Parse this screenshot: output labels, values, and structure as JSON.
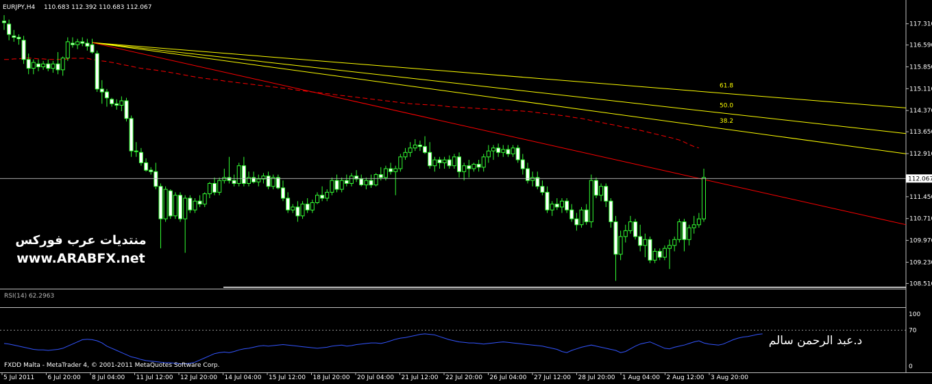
{
  "header": {
    "symbol": "EURJPY,H4",
    "ohlc": "110.683 112.392 110.683 112.067"
  },
  "watermark": {
    "forum_name": "منتديات عرب فوركس",
    "website": "www.ARABFX.net",
    "author": "د.عبد الرحمن سالم"
  },
  "footer": {
    "platform_text": "FXDD Malta - MetaTrader 4, © 2001-2011 MetaQuotes Software Corp."
  },
  "rsi": {
    "label": "RSI(14) 62.2963",
    "levels": [
      "100",
      "70",
      "0"
    ]
  },
  "fibonacci": {
    "levels": [
      "61.8",
      "50.0",
      "38.2"
    ]
  },
  "colors": {
    "background": "#000000",
    "candle_outline": "#33ff33",
    "bull_body": "#000000",
    "bear_body": "#ffffff",
    "fib_lines": "#ffff00",
    "trendline": "#ff0000",
    "moving_average": "#ff0000",
    "rsi_line": "#3355ff",
    "grid": "#c0c0c0"
  },
  "chart_data": {
    "type": "candlestick",
    "instrument": "EURJPY",
    "timeframe": "H4",
    "price_axis_ticks": [
      "117.310",
      "116.590",
      "115.850",
      "115.110",
      "114.370",
      "113.650",
      "112.910",
      "111.450",
      "110.710",
      "109.970",
      "109.230",
      "108.510"
    ],
    "current_price": "112.067",
    "time_axis_ticks": [
      "5 Jul 2011",
      "6 Jul 20:00",
      "8 Jul 04:00",
      "11 Jul 12:00",
      "12 Jul 20:00",
      "14 Jul 04:00",
      "15 Jul 12:00",
      "18 Jul 20:00",
      "20 Jul 04:00",
      "21 Jul 12:00",
      "22 Jul 20:00",
      "26 Jul 04:00",
      "27 Jul 12:00",
      "28 Jul 20:00",
      "1 Aug 04:00",
      "2 Aug 12:00",
      "3 Aug 20:00"
    ],
    "ylim": [
      108.45,
      117.65
    ],
    "candles": [
      {
        "o": 117.4,
        "h": 117.6,
        "l": 117.1,
        "c": 117.35
      },
      {
        "o": 117.3,
        "h": 117.45,
        "l": 116.75,
        "c": 116.95
      },
      {
        "o": 116.9,
        "h": 117.1,
        "l": 116.7,
        "c": 116.85
      },
      {
        "o": 116.85,
        "h": 116.95,
        "l": 116.6,
        "c": 116.8
      },
      {
        "o": 116.75,
        "h": 116.9,
        "l": 115.95,
        "c": 116.1
      },
      {
        "o": 116.1,
        "h": 116.3,
        "l": 115.6,
        "c": 115.8
      },
      {
        "o": 115.8,
        "h": 116.1,
        "l": 115.6,
        "c": 116.0
      },
      {
        "o": 115.95,
        "h": 116.1,
        "l": 115.7,
        "c": 115.85
      },
      {
        "o": 115.85,
        "h": 116.05,
        "l": 115.75,
        "c": 115.95
      },
      {
        "o": 115.95,
        "h": 116.1,
        "l": 115.7,
        "c": 115.8
      },
      {
        "o": 115.8,
        "h": 116.05,
        "l": 115.65,
        "c": 115.95
      },
      {
        "o": 115.95,
        "h": 116.35,
        "l": 115.6,
        "c": 115.75
      },
      {
        "o": 115.75,
        "h": 116.2,
        "l": 115.55,
        "c": 116.15
      },
      {
        "o": 116.15,
        "h": 116.85,
        "l": 116.05,
        "c": 116.7
      },
      {
        "o": 116.65,
        "h": 116.85,
        "l": 116.5,
        "c": 116.6
      },
      {
        "o": 116.6,
        "h": 116.8,
        "l": 116.45,
        "c": 116.7
      },
      {
        "o": 116.7,
        "h": 116.85,
        "l": 116.55,
        "c": 116.65
      },
      {
        "o": 116.65,
        "h": 116.8,
        "l": 116.4,
        "c": 116.55
      },
      {
        "o": 116.6,
        "h": 116.8,
        "l": 116.3,
        "c": 116.35
      },
      {
        "o": 116.3,
        "h": 116.4,
        "l": 115.0,
        "c": 115.1
      },
      {
        "o": 115.1,
        "h": 115.4,
        "l": 114.6,
        "c": 115.0
      },
      {
        "o": 115.0,
        "h": 115.1,
        "l": 114.5,
        "c": 114.8
      },
      {
        "o": 114.75,
        "h": 114.8,
        "l": 114.5,
        "c": 114.6
      },
      {
        "o": 114.6,
        "h": 114.75,
        "l": 114.4,
        "c": 114.55
      },
      {
        "o": 114.55,
        "h": 114.85,
        "l": 114.35,
        "c": 114.7
      },
      {
        "o": 114.7,
        "h": 114.8,
        "l": 114.0,
        "c": 114.1
      },
      {
        "o": 114.1,
        "h": 114.2,
        "l": 112.8,
        "c": 113.0
      },
      {
        "o": 113.0,
        "h": 113.3,
        "l": 112.8,
        "c": 113.0
      },
      {
        "o": 112.95,
        "h": 113.1,
        "l": 112.5,
        "c": 112.6
      },
      {
        "o": 112.6,
        "h": 112.75,
        "l": 112.3,
        "c": 112.35
      },
      {
        "o": 112.35,
        "h": 112.45,
        "l": 112.2,
        "c": 112.3
      },
      {
        "o": 112.3,
        "h": 112.6,
        "l": 111.7,
        "c": 111.8
      },
      {
        "o": 111.8,
        "h": 111.9,
        "l": 109.7,
        "c": 110.7
      },
      {
        "o": 110.7,
        "h": 111.8,
        "l": 110.6,
        "c": 111.7
      },
      {
        "o": 111.65,
        "h": 111.7,
        "l": 110.7,
        "c": 110.8
      },
      {
        "o": 110.8,
        "h": 111.6,
        "l": 110.7,
        "c": 111.5
      },
      {
        "o": 111.5,
        "h": 111.6,
        "l": 110.6,
        "c": 110.7
      },
      {
        "o": 110.7,
        "h": 111.5,
        "l": 109.55,
        "c": 111.4
      },
      {
        "o": 111.4,
        "h": 111.5,
        "l": 110.9,
        "c": 111.0
      },
      {
        "o": 111.0,
        "h": 111.4,
        "l": 110.9,
        "c": 111.3
      },
      {
        "o": 111.3,
        "h": 111.5,
        "l": 111.1,
        "c": 111.2
      },
      {
        "o": 111.2,
        "h": 111.6,
        "l": 111.1,
        "c": 111.55
      },
      {
        "o": 111.55,
        "h": 111.95,
        "l": 111.4,
        "c": 111.9
      },
      {
        "o": 111.9,
        "h": 112.1,
        "l": 111.5,
        "c": 111.6
      },
      {
        "o": 111.6,
        "h": 112.1,
        "l": 111.5,
        "c": 112.0
      },
      {
        "o": 112.0,
        "h": 112.4,
        "l": 111.9,
        "c": 112.1
      },
      {
        "o": 112.1,
        "h": 112.8,
        "l": 111.9,
        "c": 112.0
      },
      {
        "o": 112.0,
        "h": 112.2,
        "l": 111.8,
        "c": 111.9
      },
      {
        "o": 111.9,
        "h": 112.6,
        "l": 111.8,
        "c": 112.5
      },
      {
        "o": 112.5,
        "h": 112.8,
        "l": 111.8,
        "c": 111.9
      },
      {
        "o": 111.9,
        "h": 112.3,
        "l": 111.8,
        "c": 112.1
      },
      {
        "o": 112.1,
        "h": 112.3,
        "l": 111.9,
        "c": 111.95
      },
      {
        "o": 111.95,
        "h": 112.2,
        "l": 111.8,
        "c": 112.05
      },
      {
        "o": 112.05,
        "h": 112.25,
        "l": 111.9,
        "c": 112.15
      },
      {
        "o": 112.15,
        "h": 112.3,
        "l": 111.7,
        "c": 111.8
      },
      {
        "o": 111.8,
        "h": 112.2,
        "l": 111.7,
        "c": 112.1
      },
      {
        "o": 112.1,
        "h": 112.2,
        "l": 111.7,
        "c": 111.75
      },
      {
        "o": 111.75,
        "h": 112.0,
        "l": 111.3,
        "c": 111.4
      },
      {
        "o": 111.4,
        "h": 111.6,
        "l": 110.9,
        "c": 111.0
      },
      {
        "o": 111.0,
        "h": 111.2,
        "l": 110.9,
        "c": 111.1
      },
      {
        "o": 111.1,
        "h": 111.3,
        "l": 110.6,
        "c": 110.8
      },
      {
        "o": 110.8,
        "h": 111.3,
        "l": 110.7,
        "c": 111.2
      },
      {
        "o": 111.2,
        "h": 111.4,
        "l": 110.9,
        "c": 111.0
      },
      {
        "o": 111.0,
        "h": 111.35,
        "l": 110.9,
        "c": 111.25
      },
      {
        "o": 111.25,
        "h": 111.6,
        "l": 111.2,
        "c": 111.5
      },
      {
        "o": 111.5,
        "h": 111.8,
        "l": 111.3,
        "c": 111.4
      },
      {
        "o": 111.4,
        "h": 111.7,
        "l": 111.3,
        "c": 111.6
      },
      {
        "o": 111.6,
        "h": 112.1,
        "l": 111.5,
        "c": 112.0
      },
      {
        "o": 112.0,
        "h": 112.2,
        "l": 111.6,
        "c": 111.7
      },
      {
        "o": 111.7,
        "h": 112.1,
        "l": 111.6,
        "c": 112.0
      },
      {
        "o": 112.0,
        "h": 112.2,
        "l": 111.8,
        "c": 111.9
      },
      {
        "o": 111.9,
        "h": 112.25,
        "l": 111.8,
        "c": 112.15
      },
      {
        "o": 112.15,
        "h": 112.35,
        "l": 111.95,
        "c": 112.05
      },
      {
        "o": 112.05,
        "h": 112.2,
        "l": 111.8,
        "c": 111.85
      },
      {
        "o": 111.85,
        "h": 112.1,
        "l": 111.7,
        "c": 112.0
      },
      {
        "o": 112.0,
        "h": 112.2,
        "l": 111.75,
        "c": 111.85
      },
      {
        "o": 111.85,
        "h": 112.25,
        "l": 111.8,
        "c": 112.2
      },
      {
        "o": 112.2,
        "h": 112.45,
        "l": 112.0,
        "c": 112.1
      },
      {
        "o": 112.1,
        "h": 112.5,
        "l": 112.0,
        "c": 112.4
      },
      {
        "o": 112.4,
        "h": 112.6,
        "l": 112.2,
        "c": 112.3
      },
      {
        "o": 112.3,
        "h": 112.5,
        "l": 111.5,
        "c": 112.4
      },
      {
        "o": 112.4,
        "h": 112.9,
        "l": 112.3,
        "c": 112.8
      },
      {
        "o": 112.8,
        "h": 113.1,
        "l": 112.7,
        "c": 112.95
      },
      {
        "o": 112.95,
        "h": 113.3,
        "l": 112.8,
        "c": 113.1
      },
      {
        "o": 113.1,
        "h": 113.4,
        "l": 113.0,
        "c": 113.2
      },
      {
        "o": 113.2,
        "h": 113.35,
        "l": 113.0,
        "c": 113.15
      },
      {
        "o": 113.15,
        "h": 113.5,
        "l": 112.9,
        "c": 112.95
      },
      {
        "o": 112.95,
        "h": 113.3,
        "l": 112.4,
        "c": 112.5
      },
      {
        "o": 112.5,
        "h": 112.8,
        "l": 112.3,
        "c": 112.7
      },
      {
        "o": 112.7,
        "h": 112.8,
        "l": 112.4,
        "c": 112.6
      },
      {
        "o": 112.6,
        "h": 112.8,
        "l": 112.4,
        "c": 112.7
      },
      {
        "o": 112.7,
        "h": 112.85,
        "l": 112.4,
        "c": 112.5
      },
      {
        "o": 112.5,
        "h": 112.9,
        "l": 112.4,
        "c": 112.8
      },
      {
        "o": 112.8,
        "h": 112.95,
        "l": 112.1,
        "c": 112.3
      },
      {
        "o": 112.3,
        "h": 112.6,
        "l": 112.0,
        "c": 112.5
      },
      {
        "o": 112.5,
        "h": 112.7,
        "l": 112.1,
        "c": 112.4
      },
      {
        "o": 112.4,
        "h": 112.6,
        "l": 112.3,
        "c": 112.55
      },
      {
        "o": 112.55,
        "h": 112.7,
        "l": 112.3,
        "c": 112.45
      },
      {
        "o": 112.45,
        "h": 112.9,
        "l": 112.3,
        "c": 112.8
      },
      {
        "o": 112.8,
        "h": 113.2,
        "l": 112.6,
        "c": 113.0
      },
      {
        "o": 113.0,
        "h": 113.2,
        "l": 112.7,
        "c": 113.1
      },
      {
        "o": 113.1,
        "h": 113.25,
        "l": 112.8,
        "c": 112.95
      },
      {
        "o": 112.95,
        "h": 113.2,
        "l": 112.8,
        "c": 113.05
      },
      {
        "o": 113.05,
        "h": 113.2,
        "l": 112.8,
        "c": 112.9
      },
      {
        "o": 112.9,
        "h": 113.2,
        "l": 112.8,
        "c": 113.1
      },
      {
        "o": 113.1,
        "h": 113.2,
        "l": 112.6,
        "c": 112.7
      },
      {
        "o": 112.7,
        "h": 112.9,
        "l": 112.2,
        "c": 112.4
      },
      {
        "o": 112.4,
        "h": 112.6,
        "l": 111.9,
        "c": 112.0
      },
      {
        "o": 112.0,
        "h": 112.3,
        "l": 111.8,
        "c": 112.1
      },
      {
        "o": 112.1,
        "h": 112.3,
        "l": 111.7,
        "c": 111.8
      },
      {
        "o": 111.8,
        "h": 112.0,
        "l": 111.5,
        "c": 111.6
      },
      {
        "o": 111.6,
        "h": 111.8,
        "l": 110.9,
        "c": 111.0
      },
      {
        "o": 111.0,
        "h": 111.3,
        "l": 110.8,
        "c": 111.2
      },
      {
        "o": 111.2,
        "h": 111.4,
        "l": 111.0,
        "c": 111.1
      },
      {
        "o": 111.1,
        "h": 111.4,
        "l": 110.9,
        "c": 111.3
      },
      {
        "o": 111.3,
        "h": 111.4,
        "l": 110.9,
        "c": 111.0
      },
      {
        "o": 111.0,
        "h": 111.2,
        "l": 110.6,
        "c": 110.7
      },
      {
        "o": 110.7,
        "h": 110.9,
        "l": 110.3,
        "c": 110.5
      },
      {
        "o": 110.5,
        "h": 111.1,
        "l": 110.4,
        "c": 111.0
      },
      {
        "o": 111.0,
        "h": 111.2,
        "l": 110.5,
        "c": 110.6
      },
      {
        "o": 110.6,
        "h": 112.2,
        "l": 110.4,
        "c": 112.0
      },
      {
        "o": 112.0,
        "h": 112.1,
        "l": 111.4,
        "c": 111.5
      },
      {
        "o": 111.5,
        "h": 111.9,
        "l": 111.3,
        "c": 111.8
      },
      {
        "o": 111.8,
        "h": 111.9,
        "l": 111.1,
        "c": 111.3
      },
      {
        "o": 111.3,
        "h": 111.4,
        "l": 110.4,
        "c": 110.6
      },
      {
        "o": 110.6,
        "h": 110.8,
        "l": 108.6,
        "c": 109.5
      },
      {
        "o": 109.5,
        "h": 110.3,
        "l": 109.3,
        "c": 110.1
      },
      {
        "o": 110.1,
        "h": 110.5,
        "l": 109.9,
        "c": 110.3
      },
      {
        "o": 110.3,
        "h": 110.8,
        "l": 110.2,
        "c": 110.6
      },
      {
        "o": 110.6,
        "h": 110.7,
        "l": 110.0,
        "c": 110.1
      },
      {
        "o": 110.1,
        "h": 110.5,
        "l": 109.6,
        "c": 109.8
      },
      {
        "o": 109.8,
        "h": 110.2,
        "l": 109.4,
        "c": 110.0
      },
      {
        "o": 110.0,
        "h": 110.1,
        "l": 109.2,
        "c": 109.3
      },
      {
        "o": 109.3,
        "h": 109.7,
        "l": 109.2,
        "c": 109.6
      },
      {
        "o": 109.6,
        "h": 109.7,
        "l": 109.3,
        "c": 109.4
      },
      {
        "o": 109.4,
        "h": 109.8,
        "l": 109.3,
        "c": 109.7
      },
      {
        "o": 109.7,
        "h": 110.0,
        "l": 109.0,
        "c": 109.8
      },
      {
        "o": 109.8,
        "h": 110.1,
        "l": 109.6,
        "c": 110.0
      },
      {
        "o": 110.0,
        "h": 110.7,
        "l": 109.9,
        "c": 110.6
      },
      {
        "o": 110.6,
        "h": 110.7,
        "l": 109.6,
        "c": 110.0
      },
      {
        "o": 110.0,
        "h": 110.5,
        "l": 109.8,
        "c": 110.4
      },
      {
        "o": 110.4,
        "h": 110.8,
        "l": 110.2,
        "c": 110.5
      },
      {
        "o": 110.5,
        "h": 110.9,
        "l": 110.4,
        "c": 110.7
      },
      {
        "o": 110.7,
        "h": 112.4,
        "l": 110.6,
        "c": 112.1
      }
    ],
    "moving_average": [
      116.1,
      116.1,
      116.12,
      116.12,
      116.15,
      116.15,
      116.14,
      116.12,
      116.12,
      116.1,
      116.1,
      116.1,
      116.1,
      116.12,
      116.14,
      116.14,
      116.14,
      116.14,
      116.1,
      116.08,
      116.05,
      116.03,
      116.0,
      115.97,
      115.93,
      115.9,
      115.87,
      115.83,
      115.8,
      115.78,
      115.76,
      115.74,
      115.71,
      115.69,
      115.66,
      115.63,
      115.6,
      115.57,
      115.54,
      115.51,
      115.48,
      115.46,
      115.44,
      115.42,
      115.4,
      115.37,
      115.35,
      115.33,
      115.31,
      115.29,
      115.27,
      115.25,
      115.23,
      115.21,
      115.19,
      115.17,
      115.15,
      115.13,
      115.11,
      115.08,
      115.06,
      115.04,
      115.02,
      115.0,
      114.98,
      114.96,
      114.94,
      114.92,
      114.9,
      114.88,
      114.86,
      114.84,
      114.82,
      114.8,
      114.78,
      114.76,
      114.74,
      114.72,
      114.7,
      114.68,
      114.66,
      114.64,
      114.62,
      114.6,
      114.59,
      114.58,
      114.57,
      114.56,
      114.55,
      114.54,
      114.52,
      114.5,
      114.49,
      114.48,
      114.47,
      114.46,
      114.45,
      114.44,
      114.43,
      114.42,
      114.41,
      114.4,
      114.39,
      114.38,
      114.37,
      114.36,
      114.35,
      114.34,
      114.32,
      114.3,
      114.28,
      114.26,
      114.24,
      114.22,
      114.2,
      114.18,
      114.15,
      114.12,
      114.1,
      114.07,
      114.03,
      114.0,
      113.97,
      113.93,
      113.9,
      113.87,
      113.83,
      113.8,
      113.77,
      113.73,
      113.7,
      113.66,
      113.62,
      113.58,
      113.54,
      113.5,
      113.46,
      113.42,
      113.37,
      113.3,
      113.22,
      113.15,
      113.1
    ],
    "fib_levels": [
      {
        "label": "61.8",
        "start": [
          18,
          116.67
        ],
        "end": [
          200,
          114.25
        ]
      },
      {
        "label": "50.0",
        "start": [
          18,
          116.67
        ],
        "end": [
          200,
          113.3
        ]
      },
      {
        "label": "38.2",
        "start": [
          18,
          116.67
        ],
        "end": [
          200,
          112.55
        ]
      }
    ],
    "trendline": {
      "start": [
        18,
        116.67
      ],
      "end": [
        200,
        109.92
      ]
    },
    "rsi_values": [
      45,
      44,
      42,
      40,
      38,
      36,
      34,
      33,
      33,
      32,
      33,
      34,
      36,
      40,
      44,
      48,
      52,
      53,
      52,
      50,
      46,
      40,
      36,
      32,
      28,
      24,
      20,
      18,
      15,
      13,
      12,
      11,
      10,
      9,
      9,
      8,
      7,
      7,
      8,
      10,
      14,
      18,
      22,
      26,
      28,
      29,
      28,
      30,
      33,
      35,
      36,
      38,
      40,
      41,
      40,
      41,
      42,
      43,
      42,
      41,
      40,
      39,
      38,
      37,
      36,
      37,
      38,
      40,
      41,
      42,
      40,
      41,
      43,
      44,
      45,
      46,
      46,
      45,
      47,
      50,
      53,
      55,
      56,
      58,
      60,
      62,
      63,
      62,
      61,
      58,
      55,
      52,
      50,
      48,
      47,
      46,
      46,
      45,
      44,
      45,
      46,
      47,
      48,
      47,
      46,
      45,
      44,
      43,
      42,
      41,
      40,
      38,
      36,
      34,
      30,
      28,
      32,
      35,
      38,
      40,
      42,
      40,
      38,
      36,
      34,
      32,
      28,
      30,
      35,
      40,
      44,
      46,
      48,
      44,
      40,
      36,
      35,
      38,
      40,
      42,
      45,
      48,
      50,
      46,
      44,
      43,
      42,
      44,
      48,
      52,
      55,
      57,
      58,
      60,
      62,
      63
    ]
  }
}
